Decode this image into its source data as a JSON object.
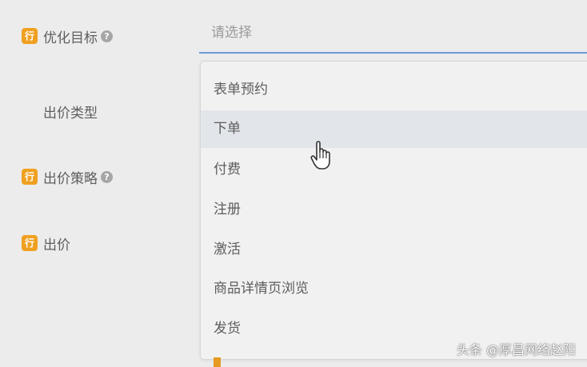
{
  "form": {
    "badge_text": "行",
    "help_symbol": "?",
    "labels": {
      "optimization_goal": "优化目标",
      "bid_type": "出价类型",
      "bid_strategy": "出价策略",
      "bid": "出价"
    },
    "select_placeholder": "请选择"
  },
  "dropdown": {
    "options": [
      "表单预约",
      "下单",
      "付费",
      "注册",
      "激活",
      "商品详情页浏览",
      "发货"
    ],
    "hovered_index": 1
  },
  "watermark": "头条 @厚昌网络赵阳",
  "colors": {
    "badge": "#f0a020",
    "focus_underline": "#6f9bd8",
    "hover_row": "#e2e5e9"
  },
  "icons": {
    "badge": "row-badge-icon",
    "help": "help-icon",
    "cursor": "hand-pointer-icon"
  }
}
